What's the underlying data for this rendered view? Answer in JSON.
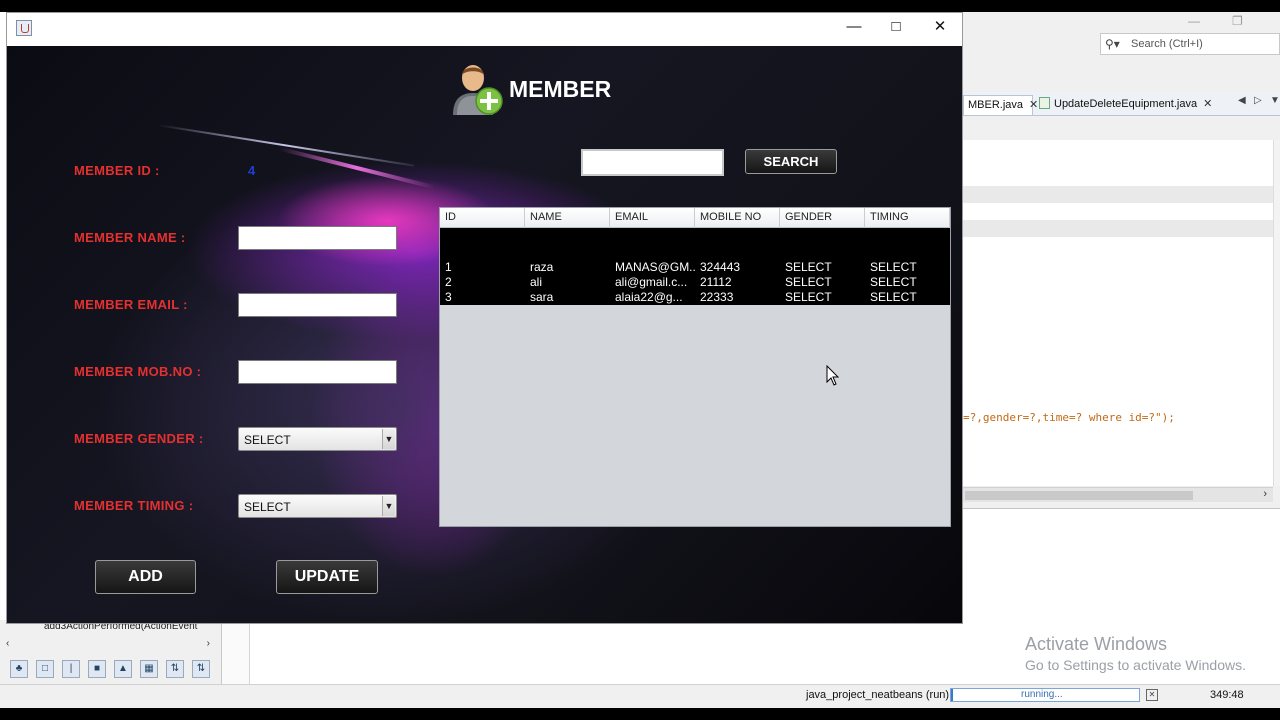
{
  "ide": {
    "search_placeholder": "Search (Ctrl+I)",
    "tabs": [
      {
        "label": "MBER.java"
      },
      {
        "label": "UpdateDeleteEquipment.java"
      }
    ],
    "code_line": "=?,gender=?,time=? where id=?\");",
    "navigator_node": "add3ActionPerformed(ActionEvent",
    "status_project": "java_project_neatbeans (run)",
    "status_progress": "running...",
    "status_position": "349:48",
    "watermark_title": "Activate Windows",
    "watermark_subtitle": "Go to Settings to activate Windows."
  },
  "app": {
    "title": "MEMBER",
    "member_id_value": "4",
    "labels": {
      "member_id": "MEMBER ID :",
      "member_name": "MEMBER NAME :",
      "member_email": "MEMBER EMAIL :",
      "member_mob": "MEMBER MOB.NO :",
      "member_gender": "MEMBER GENDER :",
      "member_timing": "MEMBER TIMING :"
    },
    "inputs": {
      "member_name": "",
      "member_email": "",
      "member_mob": "",
      "search": ""
    },
    "gender_selected": "SELECT",
    "timing_selected": "SELECT",
    "buttons": {
      "search": "SEARCH",
      "add": "ADD",
      "update": "UPDATE"
    },
    "table": {
      "columns": [
        "ID",
        "NAME",
        "EMAIL",
        "MOBILE NO",
        "GENDER",
        "TIMING"
      ],
      "rows": [
        [
          "1",
          "raza",
          "MANAS@GM...",
          "324443",
          "SELECT",
          "SELECT"
        ],
        [
          "2",
          "ali",
          "ali@gmail.c...",
          "21112",
          "SELECT",
          "SELECT"
        ],
        [
          "3",
          "sara",
          "alaia22@g...",
          "22333",
          "SELECT",
          "SELECT"
        ]
      ]
    }
  },
  "colors": {
    "label_red": "#e53030",
    "id_blue": "#1f3fd1",
    "table_body": "#000000",
    "table_empty": "#d3d7dc",
    "button_dark": "#151515"
  },
  "icons": {
    "window": "java-icon",
    "header": "add-member-icon",
    "minimize": "minimize-icon",
    "maximize": "maximize-icon",
    "close": "close-icon",
    "combo_arrow": "chevron-down-icon"
  }
}
